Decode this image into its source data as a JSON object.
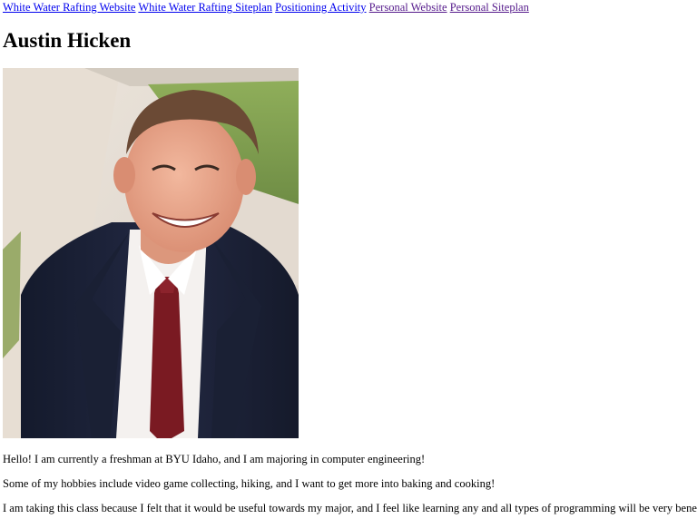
{
  "nav": {
    "links": [
      {
        "label": "White Water Rafting Website",
        "visited": false
      },
      {
        "label": "White Water Rafting Siteplan",
        "visited": false
      },
      {
        "label": "Positioning Activity",
        "visited": false
      },
      {
        "label": "Personal Website",
        "visited": true
      },
      {
        "label": "Personal Siteplan",
        "visited": true
      }
    ]
  },
  "page": {
    "title": "Austin Hicken"
  },
  "content": {
    "paragraphs": [
      "Hello! I am currently a freshman at BYU Idaho, and I am majoring in computer engineering!",
      "Some of my hobbies include video game collecting, hiking, and I want to get more into baking and cooking!",
      "I am taking this class because I felt that it would be useful towards my major, and I feel like learning any and all types of programming will be very beneficial!"
    ]
  },
  "colors": {
    "link": "#0000ee",
    "visited_link": "#551a8b",
    "suit": "#1c2135",
    "tie": "#7a1a22",
    "shirt": "#f4f1ef",
    "skin": "#e9a48a",
    "hair": "#6b4a35",
    "grass": "#7c9a4e"
  }
}
